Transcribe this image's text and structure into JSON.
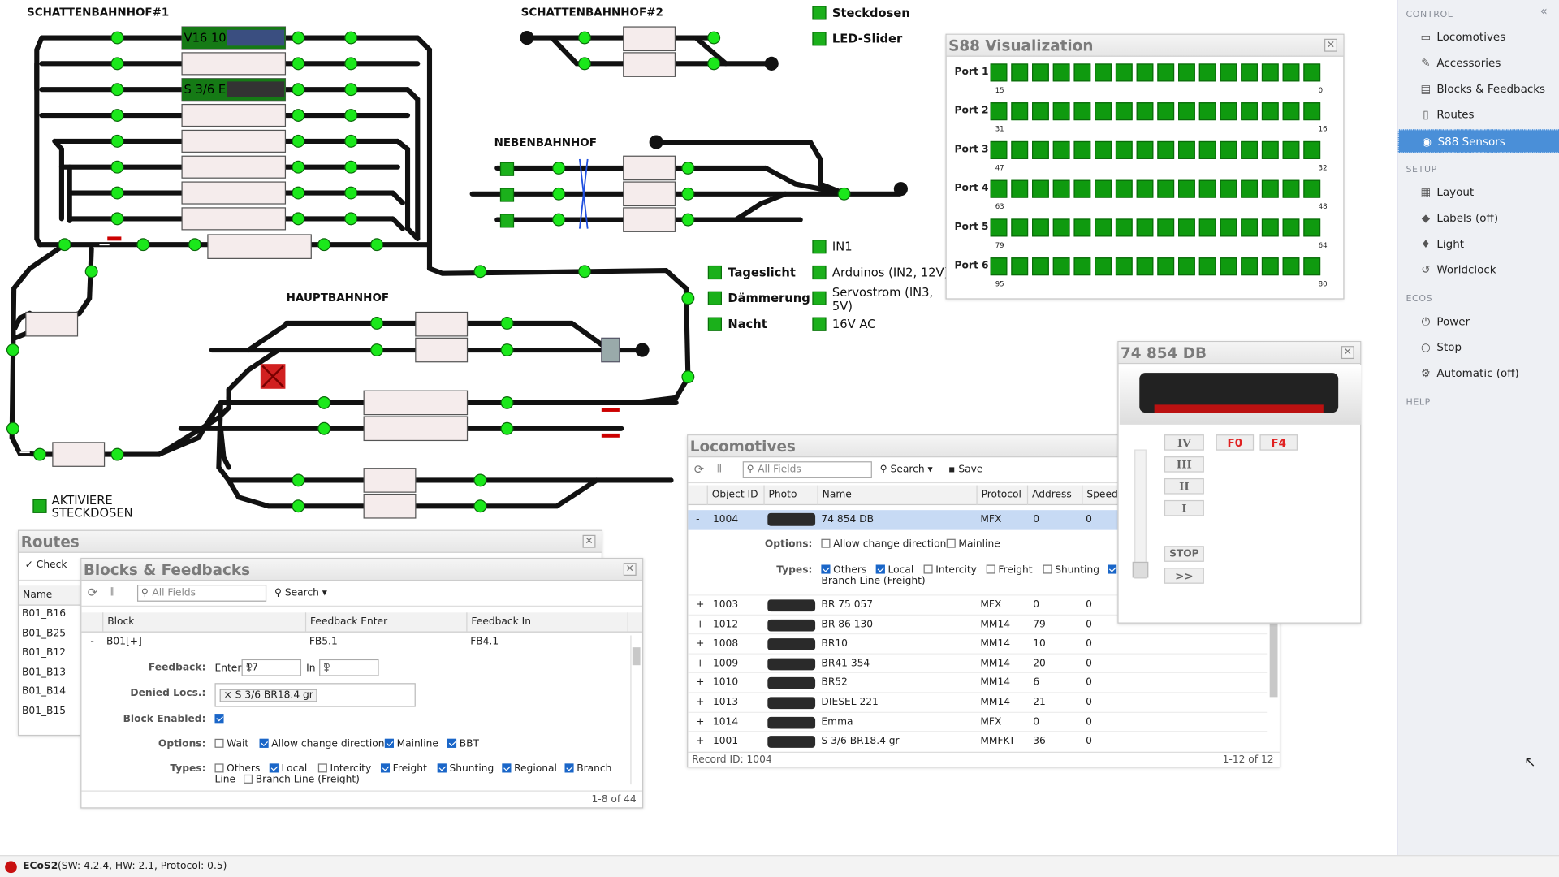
{
  "layout": {
    "stations": {
      "sbf1": "SCHATTENBAHNHOF#1",
      "sbf2": "SCHATTENBAHNHOF#2",
      "nbf": "NEBENBAHNHOF",
      "hbf": "HAUPTBAHNHOF"
    },
    "block_locos": {
      "a": "V16 10",
      "b": "S 3/6 E"
    },
    "switches": {
      "steckdosen": "Steckdosen",
      "led": "LED-Slider",
      "in1": "IN1",
      "arduinos": "Arduinos (IN2, 12V)",
      "servo1": "Servostrom (IN3,",
      "servo2": "5V)",
      "ac16": "16V AC",
      "tageslicht": "Tageslicht",
      "daemmerung": "Dämmerung",
      "nacht": "Nacht",
      "aktivieren1": "AKTIVIERE",
      "aktivieren2": "STECKDOSEN"
    }
  },
  "sidebar": {
    "sections": {
      "control": "CONTROL",
      "setup": "SETUP",
      "ecos": "ECOS",
      "help": "HELP"
    },
    "control": [
      "Locomotives",
      "Accessories",
      "Blocks & Feedbacks",
      "Routes",
      "S88 Sensors"
    ],
    "setup": [
      "Layout",
      "Labels (off)",
      "Light",
      "Worldclock"
    ],
    "ecos": [
      "Power",
      "Stop",
      "Automatic (off)"
    ],
    "active": "S88 Sensors"
  },
  "s88": {
    "title": "S88 Visualization",
    "ports": [
      {
        "label": "Port 1",
        "left": "15",
        "right": "0"
      },
      {
        "label": "Port 2",
        "left": "31",
        "right": "16"
      },
      {
        "label": "Port 3",
        "left": "47",
        "right": "32"
      },
      {
        "label": "Port 4",
        "left": "63",
        "right": "48"
      },
      {
        "label": "Port 5",
        "left": "79",
        "right": "64"
      },
      {
        "label": "Port 6",
        "left": "95",
        "right": "80"
      }
    ]
  },
  "loco_ctrl": {
    "title": "74 854 DB",
    "f0": "F0",
    "f4": "F4",
    "gears": [
      "IV",
      "III",
      "II",
      "I"
    ],
    "stop": "STOP",
    "fwd": ">>"
  },
  "locomotives": {
    "title": "Locomotives",
    "search_placeholder": "All Fields",
    "search_label": "Search",
    "save_label": "Save",
    "columns": [
      "Object ID",
      "Photo",
      "Name",
      "Protocol",
      "Address",
      "Speed"
    ],
    "expanded": {
      "toggle": "-",
      "id": "1004",
      "name": "74 854 DB",
      "protocol": "MFX",
      "address": "0",
      "speed": "0"
    },
    "options_label": "Options:",
    "opt_change": "Allow change direction",
    "opt_mainline": "Mainline",
    "types_label": "Types:",
    "type_others": "Others",
    "type_local": "Local",
    "type_intercity": "Intercity",
    "type_freight": "Freight",
    "type_shunting": "Shunting",
    "type_branch": "Branch Line (Freight)",
    "rows": [
      {
        "id": "1003",
        "name": "BR 75 057",
        "protocol": "MFX",
        "address": "0",
        "speed": "0"
      },
      {
        "id": "1012",
        "name": "BR 86 130",
        "protocol": "MM14",
        "address": "79",
        "speed": "0"
      },
      {
        "id": "1008",
        "name": "BR10",
        "protocol": "MM14",
        "address": "10",
        "speed": "0"
      },
      {
        "id": "1009",
        "name": "BR41 354",
        "protocol": "MM14",
        "address": "20",
        "speed": "0"
      },
      {
        "id": "1010",
        "name": "BR52",
        "protocol": "MM14",
        "address": "6",
        "speed": "0"
      },
      {
        "id": "1013",
        "name": "DIESEL 221",
        "protocol": "MM14",
        "address": "21",
        "speed": "0"
      },
      {
        "id": "1014",
        "name": "Emma",
        "protocol": "MFX",
        "address": "0",
        "speed": "0"
      },
      {
        "id": "1001",
        "name": "S 3/6 BR18.4 gr",
        "protocol": "MMFKT",
        "address": "36",
        "speed": "0"
      }
    ],
    "record": "Record ID: 1004",
    "count": "1-12 of 12"
  },
  "routes": {
    "title": "Routes",
    "check": "Check",
    "col": "Name",
    "rows": [
      "B01_B16",
      "B01_B25",
      "B01_B12",
      "B01_B13",
      "B01_B14",
      "B01_B15"
    ]
  },
  "blocks": {
    "title": "Blocks & Feedbacks",
    "search_placeholder": "All Fields",
    "search_label": "Search",
    "columns": [
      "Block",
      "Feedback Enter",
      "Feedback In"
    ],
    "row": {
      "toggle": "-",
      "block": "B01[+]",
      "enter": "FB5.1",
      "in": "FB4.1"
    },
    "feedback_label": "Feedback:",
    "enter_label": "Enter",
    "enter_val": "17",
    "in_label": "In",
    "in_val": "1",
    "denied_label": "Denied Locs.:",
    "denied_tag": "S 3/6 BR18.4 gr",
    "enabled_label": "Block Enabled:",
    "options_label": "Options:",
    "opt_wait": "Wait",
    "opt_change": "Allow change direction",
    "opt_mainline": "Mainline",
    "opt_bbt": "BBT",
    "types_label": "Types:",
    "t_others": "Others",
    "t_local": "Local",
    "t_intercity": "Intercity",
    "t_freight": "Freight",
    "t_shunting": "Shunting",
    "t_regional": "Regional",
    "t_branch": "Branch",
    "t_line": "Line",
    "t_branchf": "Branch Line (Freight)",
    "count": "1-8 of 44"
  },
  "status": {
    "name": "ECoS2",
    "detail": "(SW: 4.2.4, HW: 2.1, Protocol: 0.5)"
  }
}
